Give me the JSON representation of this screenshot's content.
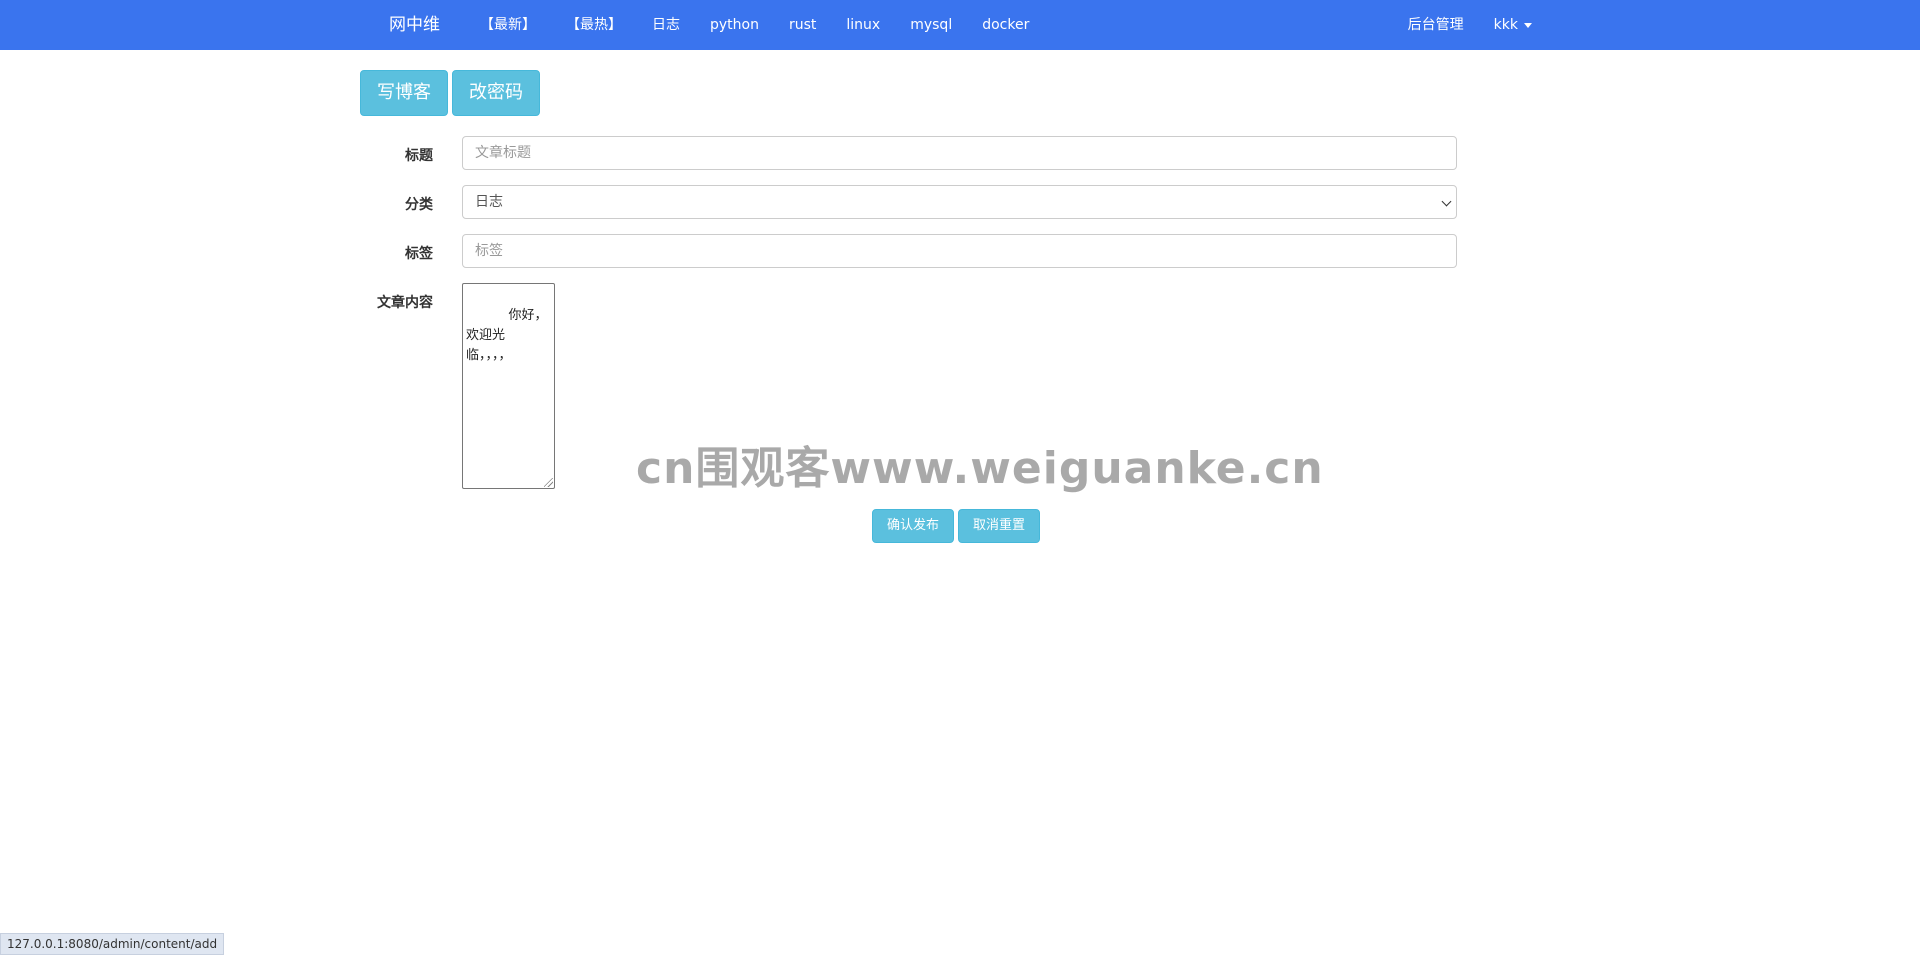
{
  "navbar": {
    "brand": "网中维",
    "links": [
      "【最新】",
      "【最热】",
      "日志",
      "python",
      "rust",
      "linux",
      "mysql",
      "docker"
    ],
    "admin_label": "后台管理",
    "user_label": "kkk",
    "background": "#3a74ee"
  },
  "top_buttons": {
    "write_blog": "写博客",
    "change_password": "改密码"
  },
  "form": {
    "title_label": "标题",
    "title_placeholder": "文章标题",
    "category_label": "分类",
    "category_value": "日志",
    "tags_label": "标签",
    "tags_placeholder": "标签",
    "content_label": "文章内容",
    "content_value": "　　你好，\n欢迎光\n临，，，，"
  },
  "actions": {
    "publish": "确认发布",
    "reset": "取消重置"
  },
  "watermark": "cn围观客www.weiguanke.cn",
  "status_bar": "127.0.0.1:8080/admin/content/add",
  "icons": {
    "user_dropdown": "caret-down-icon",
    "select_arrow": "chevron-down-icon",
    "textarea_resize": "resize-grip-icon"
  }
}
